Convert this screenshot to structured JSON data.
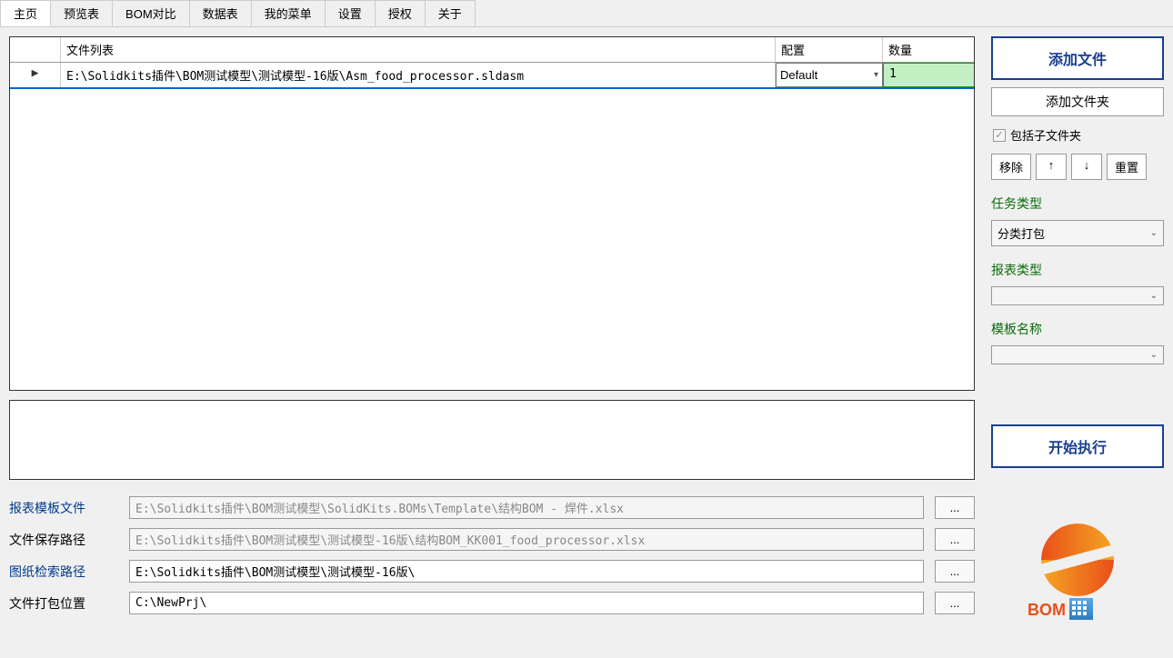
{
  "tabs": [
    "主页",
    "预览表",
    "BOM对比",
    "数据表",
    "我的菜单",
    "设置",
    "授权",
    "关于"
  ],
  "table": {
    "headers": {
      "file": "文件列表",
      "config": "配置",
      "qty": "数量"
    },
    "rows": [
      {
        "indicator": "▶",
        "file": "E:\\Solidkits插件\\BOM测试模型\\测试模型-16版\\Asm_food_processor.sldasm",
        "config": "Default",
        "qty": "1"
      }
    ]
  },
  "sidebar": {
    "add_file": "添加文件",
    "add_folder": "添加文件夹",
    "include_sub": "包括子文件夹",
    "remove": "移除",
    "up": "↑",
    "down": "↓",
    "reset": "重置",
    "task_type_label": "任务类型",
    "task_type_value": "分类打包",
    "report_type_label": "报表类型",
    "report_type_value": "",
    "template_name_label": "模板名称",
    "template_name_value": "",
    "start": "开始执行"
  },
  "paths": {
    "template_label": "报表模板文件",
    "template_value": "E:\\Solidkits插件\\BOM测试模型\\SolidKits.BOMs\\Template\\结构BOM - 焊件.xlsx",
    "save_label": "文件保存路径",
    "save_value": "E:\\Solidkits插件\\BOM测试模型\\测试模型-16版\\结构BOM_KK001_food_processor.xlsx",
    "drawing_label": "图纸检索路径",
    "drawing_value": "E:\\Solidkits插件\\BOM测试模型\\测试模型-16版\\",
    "pack_label": "文件打包位置",
    "pack_value": "C:\\NewPrj\\",
    "browse": "..."
  },
  "logo_text": "BOM"
}
